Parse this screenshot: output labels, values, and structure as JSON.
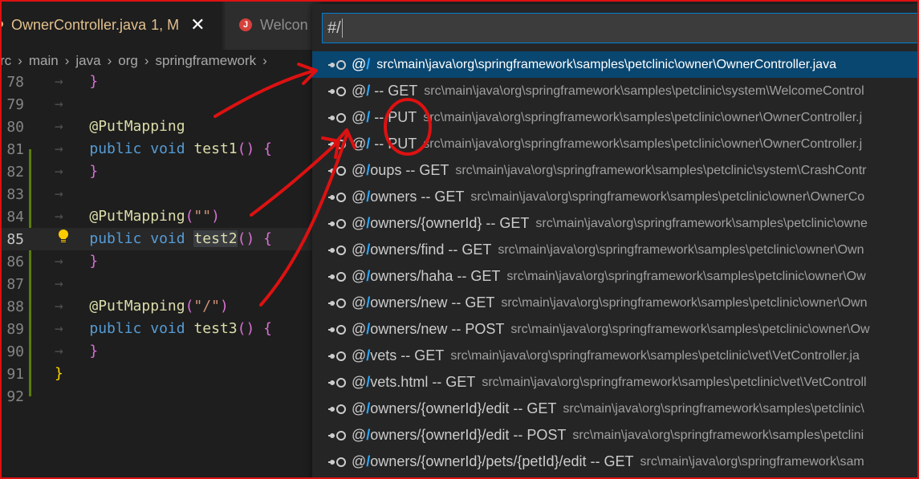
{
  "tabs": [
    {
      "name": "OwnerController.java",
      "badge": "1, M",
      "close": "✕"
    },
    {
      "name": "Welcon",
      "icon": "J"
    }
  ],
  "breadcrumb": [
    "rc",
    "main",
    "java",
    "org",
    "springframework"
  ],
  "editor": {
    "lines": [
      {
        "num": "78"
      },
      {
        "num": "79"
      },
      {
        "num": "80",
        "anno": "@PutMapping"
      },
      {
        "num": "81",
        "kw1": "public",
        "kw2": "void",
        "fn": "test1"
      },
      {
        "num": "82"
      },
      {
        "num": "83"
      },
      {
        "num": "84",
        "anno": "@PutMapping",
        "str": "\"\""
      },
      {
        "num": "85",
        "kw1": "public",
        "kw2": "void",
        "fn": "test2"
      },
      {
        "num": "86"
      },
      {
        "num": "87"
      },
      {
        "num": "88",
        "anno": "@PutMapping",
        "str": "\"/\""
      },
      {
        "num": "89",
        "kw1": "public",
        "kw2": "void",
        "fn": "test3"
      },
      {
        "num": "90"
      },
      {
        "num": "91"
      },
      {
        "num": "92"
      }
    ]
  },
  "quick_pick": {
    "input_value": "#/",
    "items": [
      {
        "pre": "@",
        "match": "/",
        "rest": "",
        "desc": "src\\main\\java\\org\\springframework\\samples\\petclinic\\owner\\OwnerController.java"
      },
      {
        "pre": "@",
        "match": "/",
        "rest": " -- GET",
        "desc": "src\\main\\java\\org\\springframework\\samples\\petclinic\\system\\WelcomeControl"
      },
      {
        "pre": "@",
        "match": "/",
        "rest": " -- PUT",
        "desc": "src\\main\\java\\org\\springframework\\samples\\petclinic\\owner\\OwnerController.j"
      },
      {
        "pre": "@",
        "match": "/",
        "rest": " -- PUT",
        "desc": "src\\main\\java\\org\\springframework\\samples\\petclinic\\owner\\OwnerController.j"
      },
      {
        "pre": "@",
        "match": "/",
        "rest": "oups -- GET",
        "desc": "src\\main\\java\\org\\springframework\\samples\\petclinic\\system\\CrashContr"
      },
      {
        "pre": "@",
        "match": "/",
        "rest": "owners -- GET",
        "desc": "src\\main\\java\\org\\springframework\\samples\\petclinic\\owner\\OwnerCo"
      },
      {
        "pre": "@",
        "match": "/",
        "rest": "owners/{ownerId} -- GET",
        "desc": "src\\main\\java\\org\\springframework\\samples\\petclinic\\owne"
      },
      {
        "pre": "@",
        "match": "/",
        "rest": "owners/find -- GET",
        "desc": "src\\main\\java\\org\\springframework\\samples\\petclinic\\owner\\Own"
      },
      {
        "pre": "@",
        "match": "/",
        "rest": "owners/haha -- GET",
        "desc": "src\\main\\java\\org\\springframework\\samples\\petclinic\\owner\\Ow"
      },
      {
        "pre": "@",
        "match": "/",
        "rest": "owners/new -- GET",
        "desc": "src\\main\\java\\org\\springframework\\samples\\petclinic\\owner\\Own"
      },
      {
        "pre": "@",
        "match": "/",
        "rest": "owners/new -- POST",
        "desc": "src\\main\\java\\org\\springframework\\samples\\petclinic\\owner\\Ow"
      },
      {
        "pre": "@",
        "match": "/",
        "rest": "vets -- GET",
        "desc": "src\\main\\java\\org\\springframework\\samples\\petclinic\\vet\\VetController.ja"
      },
      {
        "pre": "@",
        "match": "/",
        "rest": "vets.html -- GET",
        "desc": "src\\main\\java\\org\\springframework\\samples\\petclinic\\vet\\VetControll"
      },
      {
        "pre": "@",
        "match": "/",
        "rest": "owners/{ownerId}/edit -- GET",
        "desc": "src\\main\\java\\org\\springframework\\samples\\petclinic\\"
      },
      {
        "pre": "@",
        "match": "/",
        "rest": "owners/{ownerId}/edit -- POST",
        "desc": "src\\main\\java\\org\\springframework\\samples\\petclini"
      },
      {
        "pre": "@",
        "match": "/",
        "rest": "owners/{ownerId}/pets/{petId}/edit -- GET",
        "desc": "src\\main\\java\\org\\springframework\\sam"
      }
    ]
  },
  "colors": {
    "annotation": "#dd1111",
    "match": "#2aaaff",
    "selection": "#094771"
  }
}
